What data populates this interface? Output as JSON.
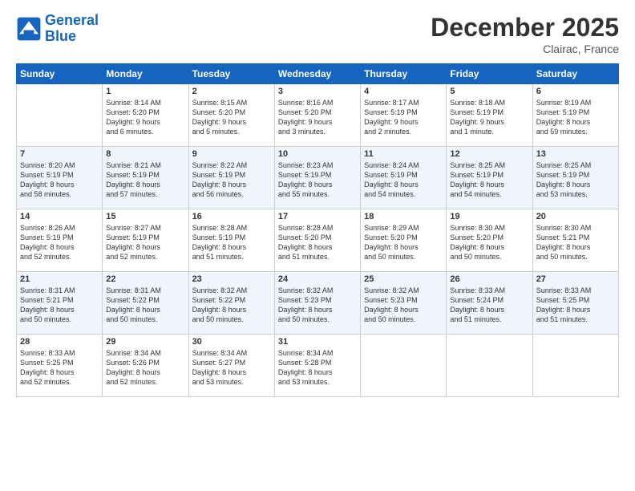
{
  "logo": {
    "line1": "General",
    "line2": "Blue"
  },
  "title": "December 2025",
  "location": "Clairac, France",
  "days_of_week": [
    "Sunday",
    "Monday",
    "Tuesday",
    "Wednesday",
    "Thursday",
    "Friday",
    "Saturday"
  ],
  "weeks": [
    [
      {
        "day": "",
        "info": ""
      },
      {
        "day": "1",
        "info": "Sunrise: 8:14 AM\nSunset: 5:20 PM\nDaylight: 9 hours\nand 6 minutes."
      },
      {
        "day": "2",
        "info": "Sunrise: 8:15 AM\nSunset: 5:20 PM\nDaylight: 9 hours\nand 5 minutes."
      },
      {
        "day": "3",
        "info": "Sunrise: 8:16 AM\nSunset: 5:20 PM\nDaylight: 9 hours\nand 3 minutes."
      },
      {
        "day": "4",
        "info": "Sunrise: 8:17 AM\nSunset: 5:19 PM\nDaylight: 9 hours\nand 2 minutes."
      },
      {
        "day": "5",
        "info": "Sunrise: 8:18 AM\nSunset: 5:19 PM\nDaylight: 9 hours\nand 1 minute."
      },
      {
        "day": "6",
        "info": "Sunrise: 8:19 AM\nSunset: 5:19 PM\nDaylight: 8 hours\nand 59 minutes."
      }
    ],
    [
      {
        "day": "7",
        "info": "Sunrise: 8:20 AM\nSunset: 5:19 PM\nDaylight: 8 hours\nand 58 minutes."
      },
      {
        "day": "8",
        "info": "Sunrise: 8:21 AM\nSunset: 5:19 PM\nDaylight: 8 hours\nand 57 minutes."
      },
      {
        "day": "9",
        "info": "Sunrise: 8:22 AM\nSunset: 5:19 PM\nDaylight: 8 hours\nand 56 minutes."
      },
      {
        "day": "10",
        "info": "Sunrise: 8:23 AM\nSunset: 5:19 PM\nDaylight: 8 hours\nand 55 minutes."
      },
      {
        "day": "11",
        "info": "Sunrise: 8:24 AM\nSunset: 5:19 PM\nDaylight: 8 hours\nand 54 minutes."
      },
      {
        "day": "12",
        "info": "Sunrise: 8:25 AM\nSunset: 5:19 PM\nDaylight: 8 hours\nand 54 minutes."
      },
      {
        "day": "13",
        "info": "Sunrise: 8:25 AM\nSunset: 5:19 PM\nDaylight: 8 hours\nand 53 minutes."
      }
    ],
    [
      {
        "day": "14",
        "info": "Sunrise: 8:26 AM\nSunset: 5:19 PM\nDaylight: 8 hours\nand 52 minutes."
      },
      {
        "day": "15",
        "info": "Sunrise: 8:27 AM\nSunset: 5:19 PM\nDaylight: 8 hours\nand 52 minutes."
      },
      {
        "day": "16",
        "info": "Sunrise: 8:28 AM\nSunset: 5:19 PM\nDaylight: 8 hours\nand 51 minutes."
      },
      {
        "day": "17",
        "info": "Sunrise: 8:28 AM\nSunset: 5:20 PM\nDaylight: 8 hours\nand 51 minutes."
      },
      {
        "day": "18",
        "info": "Sunrise: 8:29 AM\nSunset: 5:20 PM\nDaylight: 8 hours\nand 50 minutes."
      },
      {
        "day": "19",
        "info": "Sunrise: 8:30 AM\nSunset: 5:20 PM\nDaylight: 8 hours\nand 50 minutes."
      },
      {
        "day": "20",
        "info": "Sunrise: 8:30 AM\nSunset: 5:21 PM\nDaylight: 8 hours\nand 50 minutes."
      }
    ],
    [
      {
        "day": "21",
        "info": "Sunrise: 8:31 AM\nSunset: 5:21 PM\nDaylight: 8 hours\nand 50 minutes."
      },
      {
        "day": "22",
        "info": "Sunrise: 8:31 AM\nSunset: 5:22 PM\nDaylight: 8 hours\nand 50 minutes."
      },
      {
        "day": "23",
        "info": "Sunrise: 8:32 AM\nSunset: 5:22 PM\nDaylight: 8 hours\nand 50 minutes."
      },
      {
        "day": "24",
        "info": "Sunrise: 8:32 AM\nSunset: 5:23 PM\nDaylight: 8 hours\nand 50 minutes."
      },
      {
        "day": "25",
        "info": "Sunrise: 8:32 AM\nSunset: 5:23 PM\nDaylight: 8 hours\nand 50 minutes."
      },
      {
        "day": "26",
        "info": "Sunrise: 8:33 AM\nSunset: 5:24 PM\nDaylight: 8 hours\nand 51 minutes."
      },
      {
        "day": "27",
        "info": "Sunrise: 8:33 AM\nSunset: 5:25 PM\nDaylight: 8 hours\nand 51 minutes."
      }
    ],
    [
      {
        "day": "28",
        "info": "Sunrise: 8:33 AM\nSunset: 5:25 PM\nDaylight: 8 hours\nand 52 minutes."
      },
      {
        "day": "29",
        "info": "Sunrise: 8:34 AM\nSunset: 5:26 PM\nDaylight: 8 hours\nand 52 minutes."
      },
      {
        "day": "30",
        "info": "Sunrise: 8:34 AM\nSunset: 5:27 PM\nDaylight: 8 hours\nand 53 minutes."
      },
      {
        "day": "31",
        "info": "Sunrise: 8:34 AM\nSunset: 5:28 PM\nDaylight: 8 hours\nand 53 minutes."
      },
      {
        "day": "",
        "info": ""
      },
      {
        "day": "",
        "info": ""
      },
      {
        "day": "",
        "info": ""
      }
    ]
  ]
}
